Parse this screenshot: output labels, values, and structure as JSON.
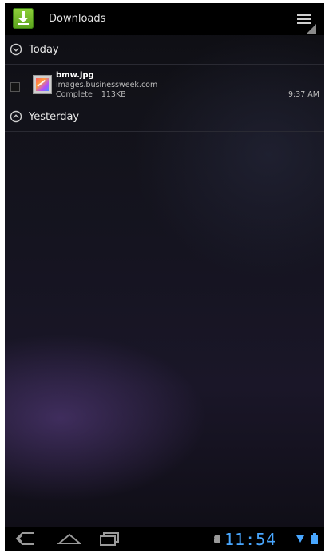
{
  "app": {
    "title": "Downloads"
  },
  "groups": [
    {
      "label": "Today",
      "expanded": true
    },
    {
      "label": "Yesterday",
      "expanded": false
    }
  ],
  "downloads": [
    {
      "filename": "bmw.jpg",
      "host": "images.businessweek.com",
      "status": "Complete",
      "size": "113KB",
      "time": "9:37 AM"
    }
  ],
  "status_bar": {
    "clock": "11:54"
  },
  "icons": {
    "app": "download-icon",
    "menu": "overflow-menu-icon",
    "back": "back-icon",
    "home": "home-icon",
    "recents": "recent-apps-icon"
  },
  "colors": {
    "accent": "#49a7ff",
    "download_green": "#5aa21c"
  }
}
